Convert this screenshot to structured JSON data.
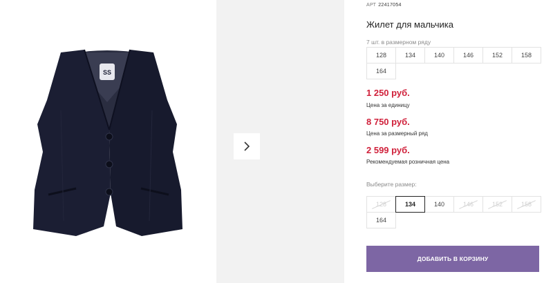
{
  "product": {
    "article_label": "АРТ",
    "article_number": "22417054",
    "title": "Жилет для мальчика"
  },
  "pack": {
    "hint": "7 шт. в размерном ряду",
    "sizes": [
      "128",
      "134",
      "140",
      "146",
      "152",
      "158",
      "164"
    ]
  },
  "prices": {
    "unit_price": "1 250 руб.",
    "unit_label": "Цена за единицу",
    "pack_price": "8 750 руб.",
    "pack_label": "Цена за размерный ряд",
    "retail_price": "2 599 руб.",
    "retail_label": "Рекомендуемая розничная цена"
  },
  "size_select": {
    "hint": "Выберите размер:",
    "options": [
      {
        "label": "128",
        "available": false
      },
      {
        "label": "134",
        "available": true,
        "selected": true
      },
      {
        "label": "140",
        "available": true
      },
      {
        "label": "146",
        "available": false
      },
      {
        "label": "152",
        "available": false
      },
      {
        "label": "158",
        "available": false
      },
      {
        "label": "164",
        "available": true
      }
    ]
  },
  "actions": {
    "add_to_cart": "ДОБАВИТЬ В КОРЗИНУ"
  },
  "icons": {
    "next": "chevron-right-icon",
    "brand_tag": "brand-tag-icon"
  },
  "colors": {
    "price": "#d0213b",
    "button": "#7d66a4",
    "garment": "#1b1e33"
  }
}
